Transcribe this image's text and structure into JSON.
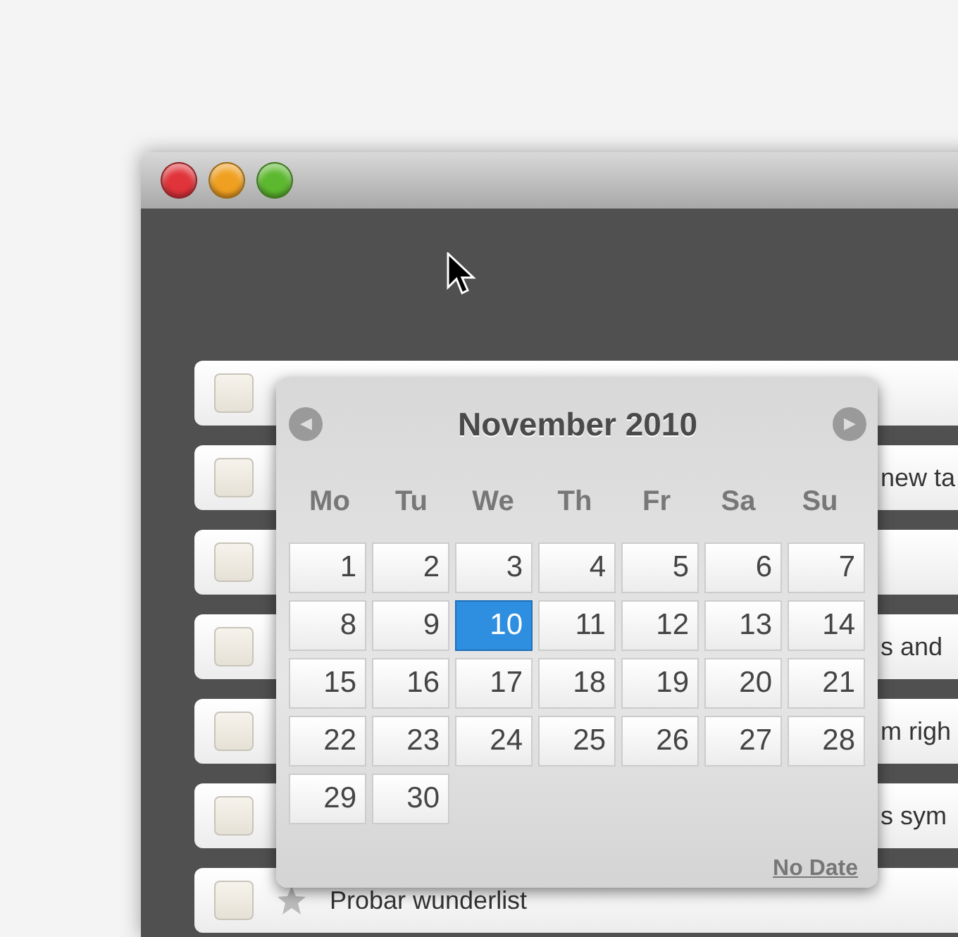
{
  "window": {
    "controls": [
      {
        "kind": "close",
        "color": "#e0333a"
      },
      {
        "kind": "minimize",
        "color": "#f0a020"
      },
      {
        "kind": "zoom",
        "color": "#5cb82e"
      }
    ]
  },
  "tasks": [
    {
      "checked": false,
      "starred": false
    },
    {
      "checked": false,
      "starred": false,
      "text": "new ta"
    },
    {
      "checked": false,
      "starred": false
    },
    {
      "checked": false,
      "starred": false,
      "text": "s and"
    },
    {
      "checked": false,
      "starred": false,
      "text": "m righ"
    },
    {
      "checked": false,
      "starred": false,
      "text": "s sym"
    },
    {
      "checked": false,
      "starred": true,
      "text": "Probar wunderlist",
      "kind": "full"
    }
  ],
  "datepicker": {
    "title": "November 2010",
    "prev": "◀",
    "next": "▶",
    "weekdays": [
      "Mo",
      "Tu",
      "We",
      "Th",
      "Fr",
      "Sa",
      "Su"
    ],
    "days": [
      {
        "label": "1",
        "selected": false
      },
      {
        "label": "2",
        "selected": false
      },
      {
        "label": "3",
        "selected": false
      },
      {
        "label": "4",
        "selected": false
      },
      {
        "label": "5",
        "selected": false
      },
      {
        "label": "6",
        "selected": false
      },
      {
        "label": "7",
        "selected": false
      },
      {
        "label": "8",
        "selected": false
      },
      {
        "label": "9",
        "selected": false
      },
      {
        "label": "10",
        "selected": true
      },
      {
        "label": "11",
        "selected": false
      },
      {
        "label": "12",
        "selected": false
      },
      {
        "label": "13",
        "selected": false
      },
      {
        "label": "14",
        "selected": false
      },
      {
        "label": "15",
        "selected": false
      },
      {
        "label": "16",
        "selected": false
      },
      {
        "label": "17",
        "selected": false
      },
      {
        "label": "18",
        "selected": false
      },
      {
        "label": "19",
        "selected": false
      },
      {
        "label": "20",
        "selected": false
      },
      {
        "label": "21",
        "selected": false
      },
      {
        "label": "22",
        "selected": false
      },
      {
        "label": "23",
        "selected": false
      },
      {
        "label": "24",
        "selected": false
      },
      {
        "label": "25",
        "selected": false
      },
      {
        "label": "26",
        "selected": false
      },
      {
        "label": "27",
        "selected": false
      },
      {
        "label": "28",
        "selected": false
      },
      {
        "label": "29",
        "selected": false
      },
      {
        "label": "30",
        "selected": false
      }
    ],
    "no_date": "No Date"
  }
}
